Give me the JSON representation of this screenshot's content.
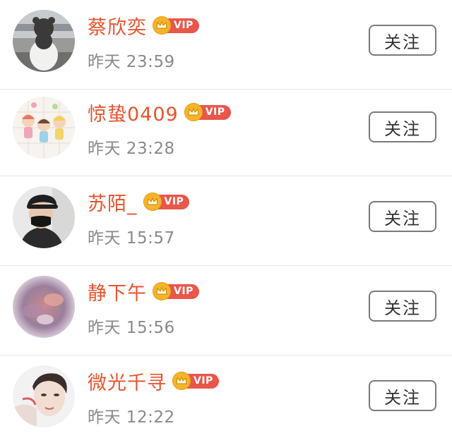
{
  "vip_badge_label": "VIP",
  "follow_label": "关注",
  "colors": {
    "username": "#e8542f",
    "vip_badge": "#e9564a",
    "vip_crown": "#f5b42a",
    "timestamp": "#8a8a8a",
    "button_border": "#7a7a7a"
  },
  "users": [
    {
      "name": "蔡欣奕",
      "time": "昨天 23:59",
      "avatar": "avatar-teddy-bear-street"
    },
    {
      "name": "惊蛰0409",
      "time": "昨天 23:28",
      "avatar": "avatar-cartoon-kids"
    },
    {
      "name": "苏陌_",
      "time": "昨天 15:57",
      "avatar": "avatar-person-cap-mask"
    },
    {
      "name": "静下午",
      "time": "昨天 15:56",
      "avatar": "avatar-pink-clouds"
    },
    {
      "name": "微光千寻",
      "time": "昨天 12:22",
      "avatar": "avatar-portrait"
    }
  ]
}
